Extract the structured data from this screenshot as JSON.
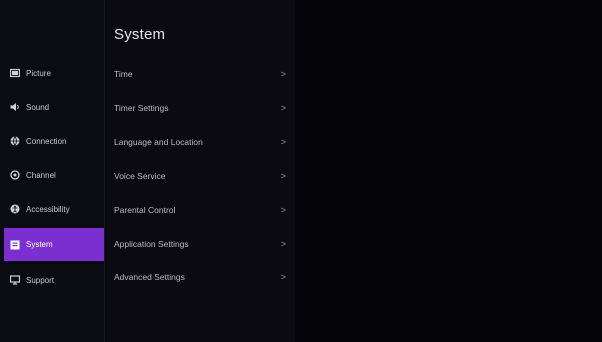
{
  "colors": {
    "background": "#050509",
    "sidebar": "#0b0b12",
    "accent": "#7b2fd0"
  },
  "sidebar": {
    "items": [
      {
        "label": "Picture",
        "icon": "picture-icon",
        "active": false
      },
      {
        "label": "Sound",
        "icon": "speaker-icon",
        "active": false
      },
      {
        "label": "Connection",
        "icon": "globe-icon",
        "active": false
      },
      {
        "label": "Channel",
        "icon": "channel-icon",
        "active": false
      },
      {
        "label": "Accessibility",
        "icon": "accessibility-icon",
        "active": false
      },
      {
        "label": "System",
        "icon": "system-icon",
        "active": true
      },
      {
        "label": "Support",
        "icon": "support-icon",
        "active": false
      }
    ]
  },
  "panel": {
    "title": "System",
    "items": [
      {
        "label": "Time"
      },
      {
        "label": "Timer Settings"
      },
      {
        "label": "Language and Location"
      },
      {
        "label": "Voice Service"
      },
      {
        "label": "Parental Control"
      },
      {
        "label": "Application Settings"
      },
      {
        "label": "Advanced Settings"
      }
    ],
    "chevron": ">"
  }
}
